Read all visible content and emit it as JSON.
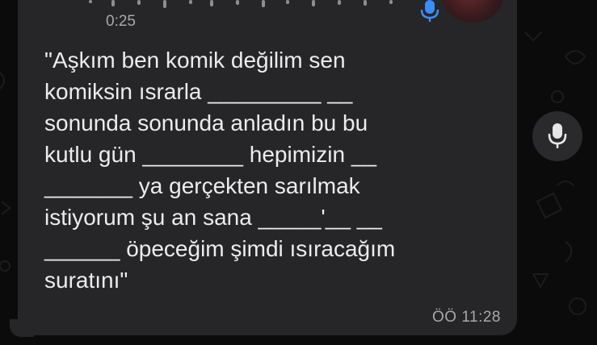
{
  "voice_message": {
    "duration": "0:25"
  },
  "message": {
    "text": "\"Aşkım ben komik değilim sen\nkomiksin ısrarla _________ __\nsonunda sonunda anladın bu bu\nkutlu gün ________ hepimizin __\n_______ ya gerçekten sarılmak\nistiyorum şu an sana _____'__ __\n______ öpeceğim şimdi ısıracağım\nsuratını\"",
    "timestamp": "ÖÖ 11:28"
  },
  "icons": {
    "mic_small": "microphone-icon",
    "mic_button": "microphone-icon"
  },
  "colors": {
    "background": "#0b0b0b",
    "bubble": "#262628",
    "text": "#ecebee",
    "meta_text": "#a8a8ab",
    "accent": "#3a8dff"
  }
}
